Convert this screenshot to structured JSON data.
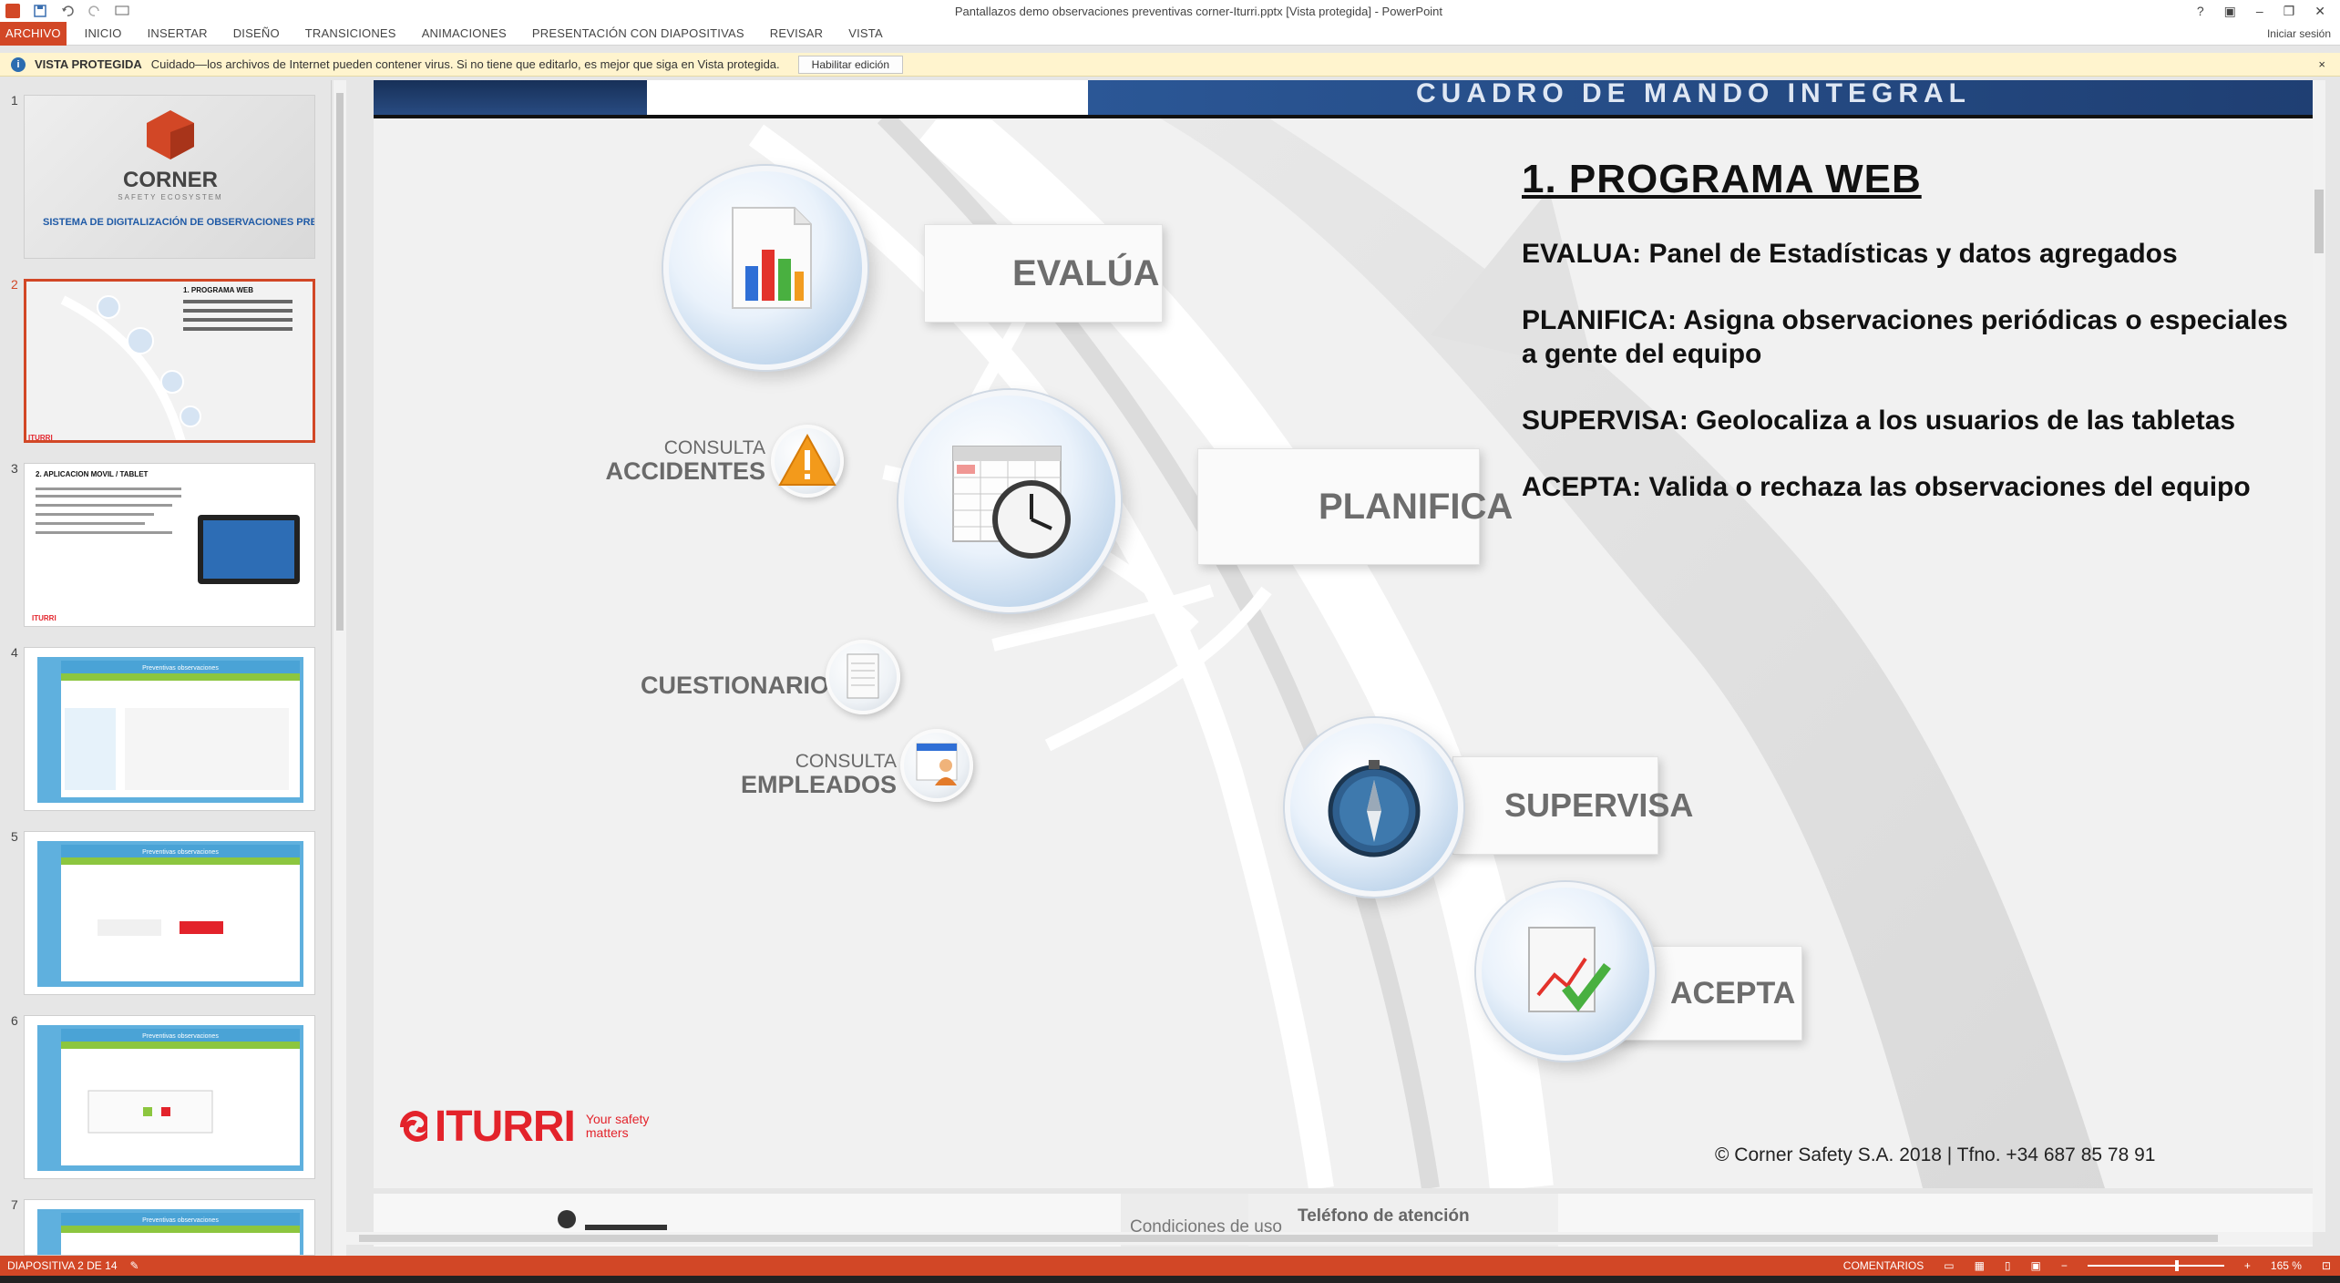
{
  "window": {
    "title": "Pantallazos demo observaciones preventivas corner-Iturri.pptx [Vista protegida] - PowerPoint",
    "controls": [
      "?",
      "▣",
      "–",
      "❐",
      "✕"
    ]
  },
  "ribbon": {
    "tabs": [
      "ARCHIVO",
      "INICIO",
      "INSERTAR",
      "DISEÑO",
      "TRANSICIONES",
      "ANIMACIONES",
      "PRESENTACIÓN CON DIAPOSITIVAS",
      "REVISAR",
      "VISTA"
    ],
    "signin": "Iniciar sesión"
  },
  "protected_bar": {
    "title": "VISTA PROTEGIDA",
    "message": "Cuidado—los archivos de Internet pueden contener virus. Si no tiene que editarlo, es mejor que siga en Vista protegida.",
    "button": "Habilitar edición",
    "close": "×"
  },
  "thumbnails": {
    "numbers": [
      "1",
      "2",
      "3",
      "4",
      "5",
      "6",
      "7"
    ],
    "slide1": {
      "brand": "CORNER",
      "sub": "SAFETY ECOSYSTEM",
      "title": "SISTEMA DE DIGITALIZACIÓN DE OBSERVACIONES PREVENTIVAS."
    },
    "slide3": {
      "title": "2. APLICACION MOVIL / TABLET"
    },
    "app_header": "Preventivas observaciones"
  },
  "slide": {
    "header_text": "CUADRO DE MANDO INTEGRAL",
    "nodes": {
      "evalua": "EVALÚA",
      "planifica": "PLANIFICA",
      "supervisa": "SUPERVISA",
      "acepta": "ACEPTA"
    },
    "side": {
      "consulta1": "CONSULTA",
      "accidentes": "ACCIDENTES",
      "cuestionario": "CUESTIONARIO",
      "consulta2": "CONSULTA",
      "empleados": "EMPLEADOS"
    },
    "title": "1. PROGRAMA WEB",
    "items": [
      "EVALUA: Panel de Estadísticas y datos agregados",
      "PLANIFICA: Asigna observaciones periódicas o especiales a gente del equipo",
      "SUPERVISA: Geolocaliza a los usuarios de las tabletas",
      "ACEPTA: Valida o rechaza las observaciones del equipo"
    ],
    "logo_word": "ITURRI",
    "logo_tag": "Your safety matters",
    "copyright": "© Corner Safety S.A. 2018 | Tfno. +34 687 85 78 91"
  },
  "next_slide_peek": {
    "uso": "Condiciones de uso",
    "telefono": "Teléfono de atención"
  },
  "status": {
    "slide_counter": "DIAPOSITIVA 2 DE 14",
    "comments": "COMENTARIOS",
    "zoom": "165 %"
  },
  "colors": {
    "accent": "#d24726",
    "iturri_red": "#e3232b",
    "info_bar": "#fff4ce"
  }
}
